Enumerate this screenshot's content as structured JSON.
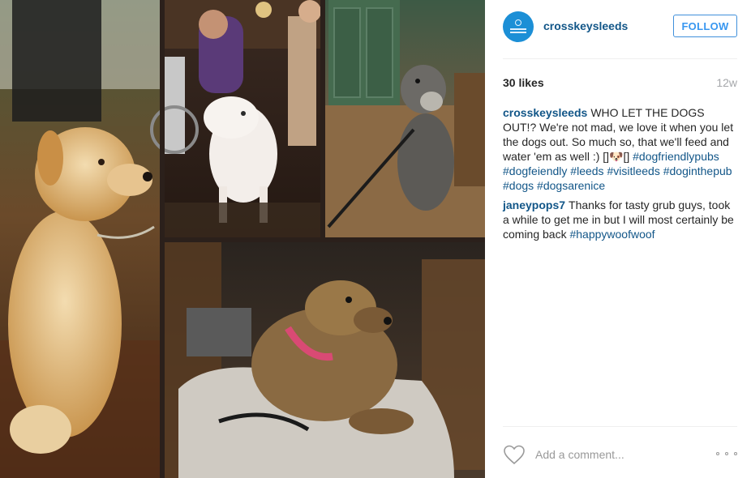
{
  "post": {
    "username": "crosskeysleeds",
    "follow_label": "FOLLOW",
    "likes": "30 likes",
    "age": "12w",
    "comments": [
      {
        "user": "crosskeysleeds",
        "text": "WHO LET THE DOGS OUT!? We're not mad, we love it when you let the dogs out. So much so, that we'll feed and water 'em as well :) []🐶[]",
        "tags": [
          "#dogfriendlypubs",
          "#dogfeiendly",
          "#leeds",
          "#visitleeds",
          "#doginthepub",
          "#dogs",
          "#dogsarenice"
        ]
      },
      {
        "user": "janeypops7",
        "text": "Thanks for tasty grub guys, took a while to get me in but I will most certainly be coming back",
        "tags": [
          "#happywoofwoof"
        ]
      }
    ],
    "add_comment_placeholder": "Add a comment...",
    "icons": {
      "like": "heart-outline-icon",
      "more": "more-options-icon",
      "avatar": "crosskeys-logo"
    },
    "colors": {
      "link": "#125688",
      "follow": "#3897f0",
      "muted": "#a5a7aa"
    }
  }
}
